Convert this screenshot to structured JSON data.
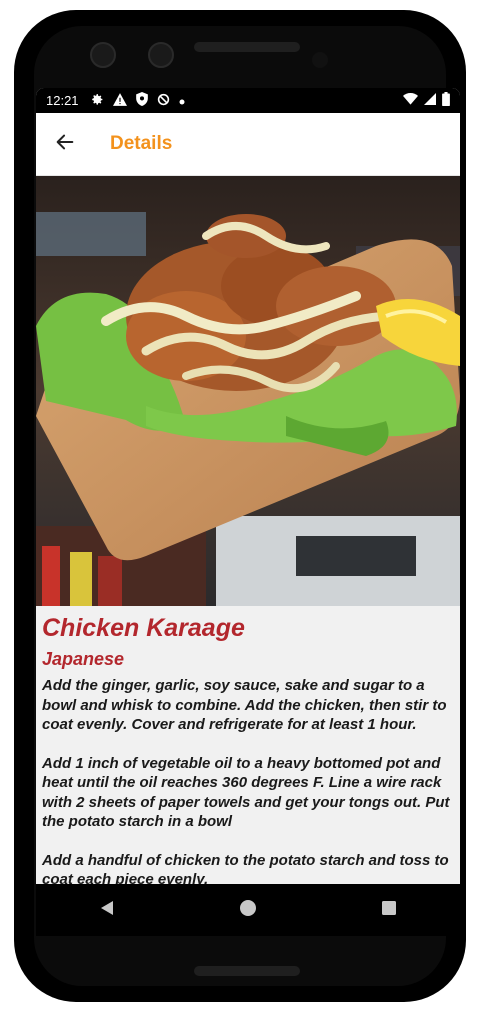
{
  "status_bar": {
    "time": "12:21",
    "left_icons": [
      "gear-icon",
      "warning-icon",
      "shield-icon",
      "data-saver-icon",
      "dot-icon"
    ],
    "right_icons": [
      "wifi-icon",
      "signal-icon",
      "battery-icon"
    ]
  },
  "app_bar": {
    "title": "Details",
    "back_icon": "arrow-left-icon",
    "title_color": "#f3921d"
  },
  "recipe": {
    "title": "Chicken Karaage",
    "cuisine": "Japanese",
    "accent_color": "#b3272d",
    "steps": [
      "Add the ginger, garlic, soy sauce, sake and sugar to a bowl and whisk to combine. Add the chicken, then stir to coat evenly. Cover and refrigerate for at least 1 hour.",
      "Add 1 inch of vegetable oil to a heavy bottomed pot and heat until the oil reaches 360 degrees F. Line a wire rack with 2 sheets of paper towels and get your tongs out. Put the potato starch in a bowl",
      "Add a handful of chicken to the potato starch and toss to coat each piece evenly."
    ]
  },
  "nav_bar": {
    "buttons": [
      "back-triangle-icon",
      "home-circle-icon",
      "recents-square-icon"
    ]
  }
}
